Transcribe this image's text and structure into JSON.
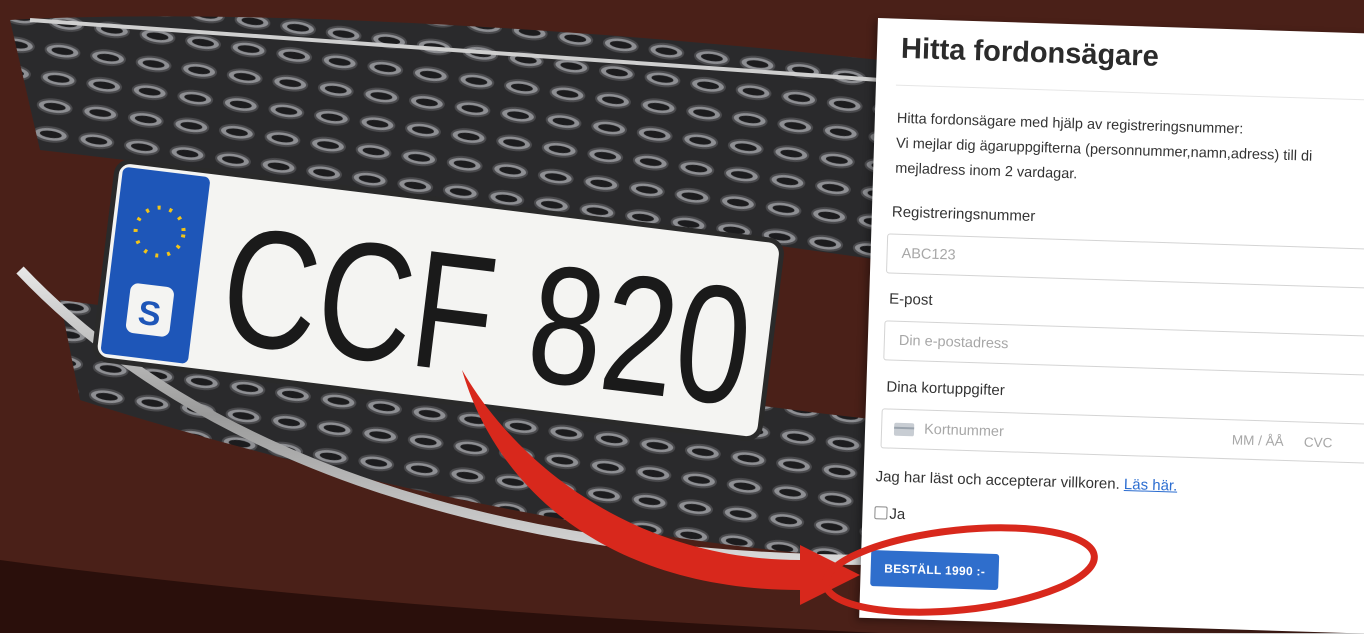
{
  "photo": {
    "plate_text": "CCF 820",
    "plate_country_code": "S"
  },
  "form": {
    "title": "Hitta fordonsägare",
    "description_line1": "Hitta fordonsägare med hjälp av registreringsnummer:",
    "description_line2": "Vi mejlar dig ägaruppgifterna (personnummer,namn,adress) till di",
    "description_line3": "mejladress inom 2 vardagar.",
    "reg_label": "Registreringsnummer",
    "reg_placeholder": "ABC123",
    "email_label": "E-post",
    "email_placeholder": "Din e-postadress",
    "card_label": "Dina kortuppgifter",
    "card_number_placeholder": "Kortnummer",
    "card_expiry_placeholder": "MM / ÅÅ",
    "card_cvc_placeholder": "CVC",
    "terms_text": "Jag har läst och accepterar villkoren.",
    "terms_link": "Läs här.",
    "checkbox_label": "Ja",
    "order_button": "BESTÄLL 1990 :-"
  },
  "colors": {
    "accent_blue": "#2f6ecc",
    "link_blue": "#2a6cd0",
    "annotation_red": "#d8281c",
    "eu_band": "#1e56b8"
  },
  "icons": {
    "card": "credit-card-icon",
    "eu_stars": "eu-stars-icon"
  }
}
